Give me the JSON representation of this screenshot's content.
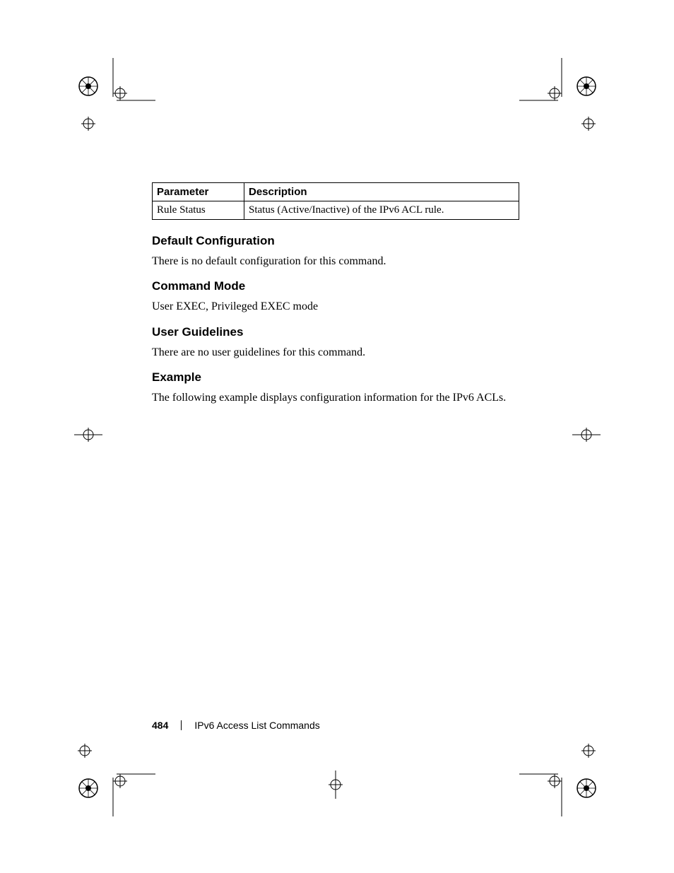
{
  "table": {
    "header_param": "Parameter",
    "header_desc": "Description",
    "row1_param": "Rule Status",
    "row1_desc": "Status (Active/Inactive) of the IPv6 ACL rule."
  },
  "sections": {
    "default_config": {
      "heading": "Default Configuration",
      "text": "There is no default configuration for this command."
    },
    "command_mode": {
      "heading": "Command Mode",
      "text": "User EXEC, Privileged EXEC mode"
    },
    "user_guidelines": {
      "heading": "User Guidelines",
      "text": "There are no user guidelines for this command."
    },
    "example": {
      "heading": "Example",
      "text": "The following example displays configuration information for the IPv6 ACLs."
    }
  },
  "footer": {
    "page_number": "484",
    "chapter": "IPv6 Access List Commands"
  }
}
